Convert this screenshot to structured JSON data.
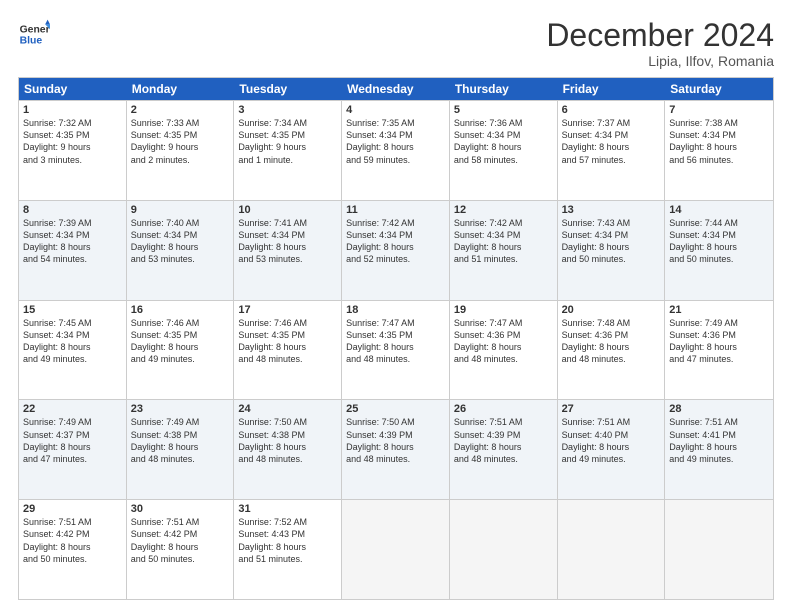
{
  "header": {
    "logo_line1": "General",
    "logo_line2": "Blue",
    "month_title": "December 2024",
    "subtitle": "Lipia, Ilfov, Romania"
  },
  "days_of_week": [
    "Sunday",
    "Monday",
    "Tuesday",
    "Wednesday",
    "Thursday",
    "Friday",
    "Saturday"
  ],
  "rows": [
    [
      {
        "day": "1",
        "lines": [
          "Sunrise: 7:32 AM",
          "Sunset: 4:35 PM",
          "Daylight: 9 hours",
          "and 3 minutes."
        ]
      },
      {
        "day": "2",
        "lines": [
          "Sunrise: 7:33 AM",
          "Sunset: 4:35 PM",
          "Daylight: 9 hours",
          "and 2 minutes."
        ]
      },
      {
        "day": "3",
        "lines": [
          "Sunrise: 7:34 AM",
          "Sunset: 4:35 PM",
          "Daylight: 9 hours",
          "and 1 minute."
        ]
      },
      {
        "day": "4",
        "lines": [
          "Sunrise: 7:35 AM",
          "Sunset: 4:34 PM",
          "Daylight: 8 hours",
          "and 59 minutes."
        ]
      },
      {
        "day": "5",
        "lines": [
          "Sunrise: 7:36 AM",
          "Sunset: 4:34 PM",
          "Daylight: 8 hours",
          "and 58 minutes."
        ]
      },
      {
        "day": "6",
        "lines": [
          "Sunrise: 7:37 AM",
          "Sunset: 4:34 PM",
          "Daylight: 8 hours",
          "and 57 minutes."
        ]
      },
      {
        "day": "7",
        "lines": [
          "Sunrise: 7:38 AM",
          "Sunset: 4:34 PM",
          "Daylight: 8 hours",
          "and 56 minutes."
        ]
      }
    ],
    [
      {
        "day": "8",
        "lines": [
          "Sunrise: 7:39 AM",
          "Sunset: 4:34 PM",
          "Daylight: 8 hours",
          "and 54 minutes."
        ]
      },
      {
        "day": "9",
        "lines": [
          "Sunrise: 7:40 AM",
          "Sunset: 4:34 PM",
          "Daylight: 8 hours",
          "and 53 minutes."
        ]
      },
      {
        "day": "10",
        "lines": [
          "Sunrise: 7:41 AM",
          "Sunset: 4:34 PM",
          "Daylight: 8 hours",
          "and 53 minutes."
        ]
      },
      {
        "day": "11",
        "lines": [
          "Sunrise: 7:42 AM",
          "Sunset: 4:34 PM",
          "Daylight: 8 hours",
          "and 52 minutes."
        ]
      },
      {
        "day": "12",
        "lines": [
          "Sunrise: 7:42 AM",
          "Sunset: 4:34 PM",
          "Daylight: 8 hours",
          "and 51 minutes."
        ]
      },
      {
        "day": "13",
        "lines": [
          "Sunrise: 7:43 AM",
          "Sunset: 4:34 PM",
          "Daylight: 8 hours",
          "and 50 minutes."
        ]
      },
      {
        "day": "14",
        "lines": [
          "Sunrise: 7:44 AM",
          "Sunset: 4:34 PM",
          "Daylight: 8 hours",
          "and 50 minutes."
        ]
      }
    ],
    [
      {
        "day": "15",
        "lines": [
          "Sunrise: 7:45 AM",
          "Sunset: 4:34 PM",
          "Daylight: 8 hours",
          "and 49 minutes."
        ]
      },
      {
        "day": "16",
        "lines": [
          "Sunrise: 7:46 AM",
          "Sunset: 4:35 PM",
          "Daylight: 8 hours",
          "and 49 minutes."
        ]
      },
      {
        "day": "17",
        "lines": [
          "Sunrise: 7:46 AM",
          "Sunset: 4:35 PM",
          "Daylight: 8 hours",
          "and 48 minutes."
        ]
      },
      {
        "day": "18",
        "lines": [
          "Sunrise: 7:47 AM",
          "Sunset: 4:35 PM",
          "Daylight: 8 hours",
          "and 48 minutes."
        ]
      },
      {
        "day": "19",
        "lines": [
          "Sunrise: 7:47 AM",
          "Sunset: 4:36 PM",
          "Daylight: 8 hours",
          "and 48 minutes."
        ]
      },
      {
        "day": "20",
        "lines": [
          "Sunrise: 7:48 AM",
          "Sunset: 4:36 PM",
          "Daylight: 8 hours",
          "and 48 minutes."
        ]
      },
      {
        "day": "21",
        "lines": [
          "Sunrise: 7:49 AM",
          "Sunset: 4:36 PM",
          "Daylight: 8 hours",
          "and 47 minutes."
        ]
      }
    ],
    [
      {
        "day": "22",
        "lines": [
          "Sunrise: 7:49 AM",
          "Sunset: 4:37 PM",
          "Daylight: 8 hours",
          "and 47 minutes."
        ]
      },
      {
        "day": "23",
        "lines": [
          "Sunrise: 7:49 AM",
          "Sunset: 4:38 PM",
          "Daylight: 8 hours",
          "and 48 minutes."
        ]
      },
      {
        "day": "24",
        "lines": [
          "Sunrise: 7:50 AM",
          "Sunset: 4:38 PM",
          "Daylight: 8 hours",
          "and 48 minutes."
        ]
      },
      {
        "day": "25",
        "lines": [
          "Sunrise: 7:50 AM",
          "Sunset: 4:39 PM",
          "Daylight: 8 hours",
          "and 48 minutes."
        ]
      },
      {
        "day": "26",
        "lines": [
          "Sunrise: 7:51 AM",
          "Sunset: 4:39 PM",
          "Daylight: 8 hours",
          "and 48 minutes."
        ]
      },
      {
        "day": "27",
        "lines": [
          "Sunrise: 7:51 AM",
          "Sunset: 4:40 PM",
          "Daylight: 8 hours",
          "and 49 minutes."
        ]
      },
      {
        "day": "28",
        "lines": [
          "Sunrise: 7:51 AM",
          "Sunset: 4:41 PM",
          "Daylight: 8 hours",
          "and 49 minutes."
        ]
      }
    ],
    [
      {
        "day": "29",
        "lines": [
          "Sunrise: 7:51 AM",
          "Sunset: 4:42 PM",
          "Daylight: 8 hours",
          "and 50 minutes."
        ]
      },
      {
        "day": "30",
        "lines": [
          "Sunrise: 7:51 AM",
          "Sunset: 4:42 PM",
          "Daylight: 8 hours",
          "and 50 minutes."
        ]
      },
      {
        "day": "31",
        "lines": [
          "Sunrise: 7:52 AM",
          "Sunset: 4:43 PM",
          "Daylight: 8 hours",
          "and 51 minutes."
        ]
      },
      {
        "day": "",
        "lines": []
      },
      {
        "day": "",
        "lines": []
      },
      {
        "day": "",
        "lines": []
      },
      {
        "day": "",
        "lines": []
      }
    ]
  ],
  "alt_rows": [
    1,
    3
  ]
}
